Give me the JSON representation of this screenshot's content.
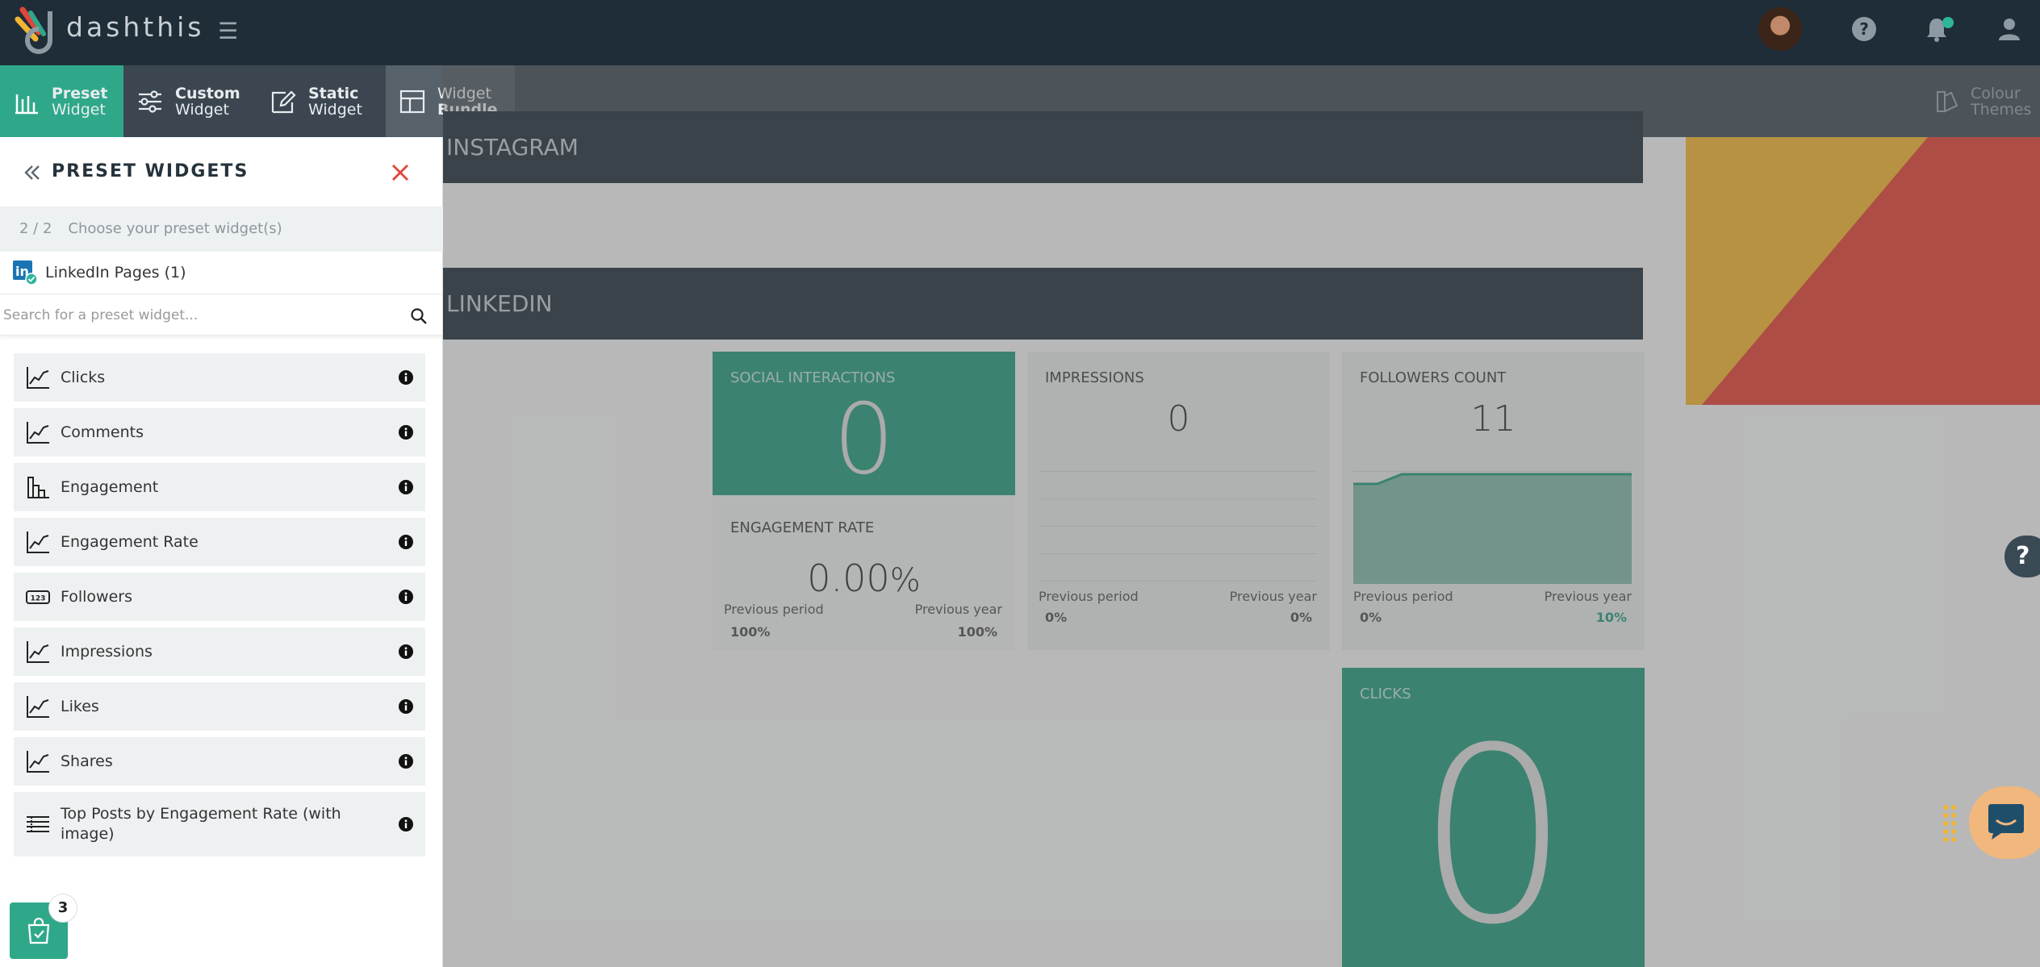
{
  "app": {
    "brand": "dashthis"
  },
  "header_icons": [
    "hamburger-icon",
    "help-icon",
    "bell-icon",
    "user-icon"
  ],
  "tabs": [
    {
      "line1": "Preset",
      "line2": "Widget",
      "icon": "bar-chart-icon",
      "active": true
    },
    {
      "line1": "Custom",
      "line2": "Widget",
      "icon": "sliders-icon",
      "active": false
    },
    {
      "line1": "Static",
      "line2": "Widget",
      "icon": "edit-icon",
      "active": false
    },
    {
      "line1": "Widget",
      "line2": "Bundle",
      "icon": "layout-icon",
      "active": false
    }
  ],
  "colour_themes": {
    "line1": "Colour",
    "line2": "Themes"
  },
  "panel": {
    "title": "PRESET WIDGETS",
    "step": "2 / 2",
    "step_label": "Choose your preset widget(s)",
    "source": "LinkedIn Pages (1)",
    "search_placeholder": "Search for a preset widget...",
    "widgets": [
      {
        "label": "Clicks",
        "icon": "line-chart-icon"
      },
      {
        "label": "Comments",
        "icon": "line-chart-icon"
      },
      {
        "label": "Engagement",
        "icon": "bar-chart-icon"
      },
      {
        "label": "Engagement Rate",
        "icon": "line-chart-icon"
      },
      {
        "label": "Followers",
        "icon": "number-icon",
        "icon_text": "123"
      },
      {
        "label": "Impressions",
        "icon": "line-chart-icon"
      },
      {
        "label": "Likes",
        "icon": "line-chart-icon"
      },
      {
        "label": "Shares",
        "icon": "line-chart-icon"
      },
      {
        "label": "Top Posts by Engagement Rate (with image)",
        "icon": "table-icon"
      }
    ],
    "cart_count": "3"
  },
  "dashboard": {
    "sections": [
      {
        "title": "INSTAGRAM"
      },
      {
        "title": "LINKEDIN"
      }
    ],
    "cards": {
      "social_interactions": {
        "title": "SOCIAL INTERACTIONS",
        "value": "0"
      },
      "engagement_rate": {
        "title": "ENGAGEMENT RATE",
        "value": "0.00",
        "unit": "%",
        "prev_period_label": "Previous period",
        "prev_year_label": "Previous year",
        "prev_period": "100%",
        "prev_year": "100%"
      },
      "impressions": {
        "title": "IMPRESSIONS",
        "value": "0",
        "prev_period_label": "Previous period",
        "prev_year_label": "Previous year",
        "prev_period": "0%",
        "prev_year": "0%"
      },
      "followers_count": {
        "title": "FOLLOWERS COUNT",
        "value": "11",
        "prev_period_label": "Previous period",
        "prev_year_label": "Previous year",
        "prev_period": "0%",
        "prev_year": "10%"
      },
      "clicks": {
        "title": "CLICKS",
        "value": "0"
      }
    }
  },
  "help_widget": "?",
  "colors": {
    "accent": "#2fa88a",
    "header": "#1f2d38",
    "close": "#e0463a"
  }
}
